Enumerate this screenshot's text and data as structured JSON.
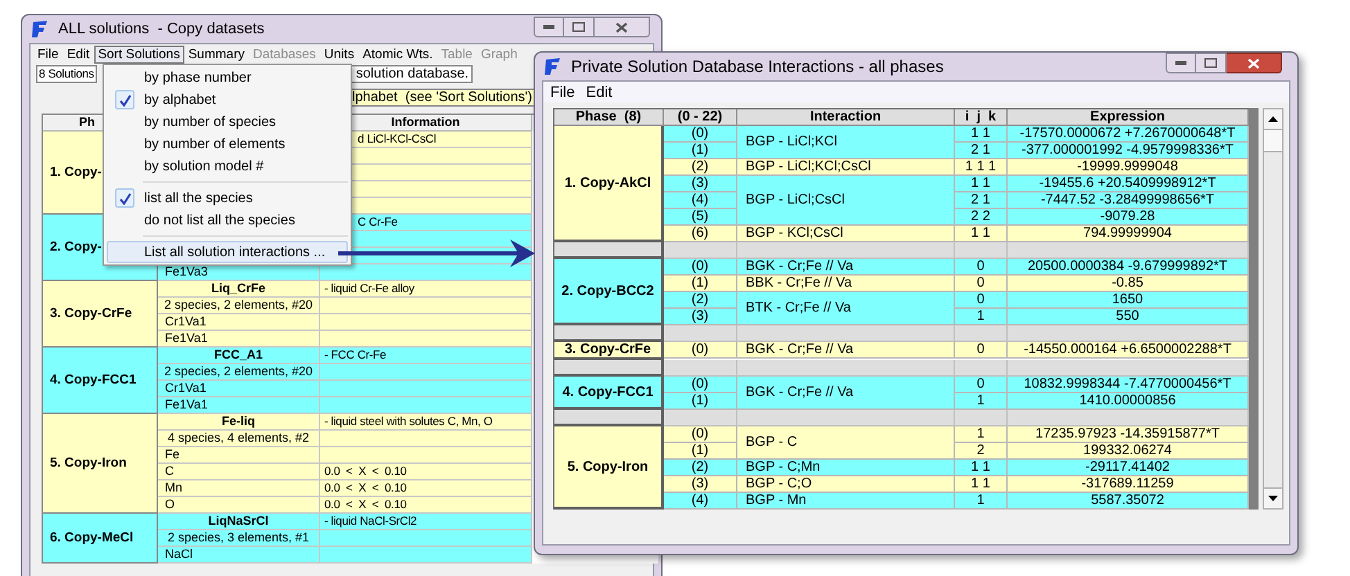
{
  "left_window": {
    "title": "ALL solutions  - Copy datasets",
    "active": false,
    "menu": [
      {
        "label": "File",
        "disabled": false,
        "selected": false
      },
      {
        "label": "Edit",
        "disabled": false,
        "selected": false
      },
      {
        "label": "Sort Solutions",
        "disabled": false,
        "selected": true
      },
      {
        "label": "Summary",
        "disabled": false,
        "selected": false
      },
      {
        "label": "Databases",
        "disabled": true,
        "selected": false
      },
      {
        "label": "Units",
        "disabled": false,
        "selected": false
      },
      {
        "label": "Atomic Wts.",
        "disabled": false,
        "selected": false
      },
      {
        "label": "Table",
        "disabled": true,
        "selected": false
      },
      {
        "label": "Graph",
        "disabled": true,
        "selected": false
      }
    ],
    "count_box": "8 Solutions",
    "source_box": "solution database.",
    "sort_note": "lphabet  (see 'Sort Solutions')",
    "table": {
      "columns": [
        "Ph",
        "Information"
      ],
      "groups": [
        {
          "phase": "1. Copy-",
          "rows": [
            {
              "kind": "name",
              "info": "d LiCl-KCl-CsCl"
            },
            {
              "kind": "count"
            },
            {
              "kind": "species"
            },
            {
              "kind": "species"
            },
            {
              "kind": "species"
            }
          ]
        },
        {
          "phase": "2. Copy-",
          "rows": [
            {
              "kind": "name",
              "info": "C Cr-Fe"
            },
            {
              "kind": "count"
            },
            {
              "kind": "species"
            },
            {
              "kind": "species",
              "name": "Fe1Va3"
            }
          ]
        },
        {
          "phase": "3. Copy-CrFe",
          "rows": [
            {
              "kind": "name",
              "name": "Liq_CrFe",
              "info": "- liquid Cr-Fe alloy"
            },
            {
              "kind": "count",
              "name": "2 species, 2 elements, #20"
            },
            {
              "kind": "species",
              "name": "Cr1Va1"
            },
            {
              "kind": "species",
              "name": "Fe1Va1"
            }
          ]
        },
        {
          "phase": "4. Copy-FCC1",
          "rows": [
            {
              "kind": "name",
              "name": "FCC_A1",
              "info": "- FCC Cr-Fe"
            },
            {
              "kind": "count",
              "name": "2 species, 2 elements, #20"
            },
            {
              "kind": "species",
              "name": "Cr1Va1"
            },
            {
              "kind": "species",
              "name": "Fe1Va1"
            }
          ]
        },
        {
          "phase": "5. Copy-Iron",
          "rows": [
            {
              "kind": "name",
              "name": "Fe-liq",
              "info": "- liquid steel with solutes C, Mn, O"
            },
            {
              "kind": "count",
              "name": "4 species, 4 elements, #2"
            },
            {
              "kind": "species",
              "name": "Fe"
            },
            {
              "kind": "species",
              "name": "C",
              "info": "0.0  <  X  <  0.10"
            },
            {
              "kind": "species",
              "name": "Mn",
              "info": "0.0  <  X  <  0.10"
            },
            {
              "kind": "species",
              "name": "O",
              "info": "0.0  <  X  <  0.10"
            }
          ]
        },
        {
          "phase": "6. Copy-MeCl",
          "rows": [
            {
              "kind": "name",
              "name": "LiqNaSrCl",
              "info": "- liquid NaCl-SrCl2"
            },
            {
              "kind": "count",
              "name": "2 species, 3 elements, #1"
            },
            {
              "kind": "species",
              "name": "NaCl"
            }
          ]
        }
      ]
    }
  },
  "sort_menu": {
    "items": [
      {
        "kind": "option",
        "label": "by phase number",
        "checked": false,
        "highlighted": false
      },
      {
        "kind": "option",
        "label": "by alphabet",
        "checked": true,
        "highlighted": false
      },
      {
        "kind": "option",
        "label": "by number of species",
        "checked": false,
        "highlighted": false
      },
      {
        "kind": "option",
        "label": "by number of elements",
        "checked": false,
        "highlighted": false
      },
      {
        "kind": "option",
        "label": "by solution model #",
        "checked": false,
        "highlighted": false
      },
      {
        "kind": "separator"
      },
      {
        "kind": "option",
        "label": "list all the species",
        "checked": true,
        "highlighted": false
      },
      {
        "kind": "option",
        "label": "do not list all the species",
        "checked": false,
        "highlighted": false
      },
      {
        "kind": "separator"
      },
      {
        "kind": "option",
        "label": "List all solution interactions ...",
        "checked": false,
        "highlighted": true
      }
    ]
  },
  "right_window": {
    "title": "Private Solution Database Interactions - all phases",
    "active": true,
    "menu": [
      "File",
      "Edit"
    ],
    "table": {
      "columns": [
        "Phase  (8)",
        "(0 - 22)",
        "Interaction",
        "i  j  k",
        "Expression"
      ],
      "phases": [
        {
          "phase": "1. Copy-AkCl",
          "interactions": [
            {
              "name": "BGP - LiCl;KCl",
              "terms": [
                {
                  "index": "(0)",
                  "ijk": "1 1",
                  "expression": "-17570.0000672 +7.2670000648*T"
                },
                {
                  "index": "(1)",
                  "ijk": "2 1",
                  "expression": "-377.000001992 -4.9579998336*T"
                }
              ]
            },
            {
              "name": "BGP - LiCl;KCl;CsCl",
              "terms": [
                {
                  "index": "(2)",
                  "ijk": "1 1 1",
                  "expression": "-19999.9999048"
                }
              ]
            },
            {
              "name": "BGP - LiCl;CsCl",
              "terms": [
                {
                  "index": "(3)",
                  "ijk": "1 1",
                  "expression": "-19455.6 +20.5409998912*T"
                },
                {
                  "index": "(4)",
                  "ijk": "2 1",
                  "expression": "-7447.52 -3.28499998656*T"
                },
                {
                  "index": "(5)",
                  "ijk": "2 2",
                  "expression": "-9079.28"
                }
              ]
            },
            {
              "name": "BGP - KCl;CsCl",
              "terms": [
                {
                  "index": "(6)",
                  "ijk": "1 1",
                  "expression": "794.99999904"
                }
              ]
            }
          ]
        },
        {
          "phase": "2. Copy-BCC2",
          "interactions": [
            {
              "name": "BGK - Cr;Fe // Va",
              "terms": [
                {
                  "index": "(0)",
                  "ijk": "0",
                  "expression": "20500.0000384 -9.679999892*T"
                }
              ]
            },
            {
              "name": "BBK - Cr;Fe // Va",
              "terms": [
                {
                  "index": "(1)",
                  "ijk": "0",
                  "expression": "-0.85"
                }
              ]
            },
            {
              "name": "BTK - Cr;Fe // Va",
              "terms": [
                {
                  "index": "(2)",
                  "ijk": "0",
                  "expression": "1650"
                },
                {
                  "index": "(3)",
                  "ijk": "1",
                  "expression": "550"
                }
              ]
            }
          ]
        },
        {
          "phase": "3. Copy-CrFe",
          "interactions": [
            {
              "name": "BGK - Cr;Fe // Va",
              "terms": [
                {
                  "index": "(0)",
                  "ijk": "0",
                  "expression": "-14550.000164 +6.6500002288*T"
                }
              ]
            }
          ]
        },
        {
          "phase": "4. Copy-FCC1",
          "interactions": [
            {
              "name": "BGK - Cr;Fe // Va",
              "terms": [
                {
                  "index": "(0)",
                  "ijk": "0",
                  "expression": "10832.9998344 -7.4770000456*T"
                },
                {
                  "index": "(1)",
                  "ijk": "1",
                  "expression": "1410.00000856"
                }
              ]
            }
          ]
        },
        {
          "phase": "5. Copy-Iron",
          "interactions": [
            {
              "name": "BGP - C",
              "terms": [
                {
                  "index": "(0)",
                  "ijk": "1",
                  "expression": "17235.97923 -14.35915877*T"
                },
                {
                  "index": "(1)",
                  "ijk": "2",
                  "expression": "199332.06274"
                }
              ]
            },
            {
              "name": "BGP - C;Mn",
              "terms": [
                {
                  "index": "(2)",
                  "ijk": "1 1",
                  "expression": "-29117.41402"
                }
              ]
            },
            {
              "name": "BGP - C;O",
              "terms": [
                {
                  "index": "(3)",
                  "ijk": "1 1",
                  "expression": "-317689.11259"
                }
              ]
            },
            {
              "name": "BGP - Mn",
              "terms": [
                {
                  "index": "(4)",
                  "ijk": "1",
                  "expression": "5587.35072"
                }
              ]
            }
          ]
        }
      ]
    }
  }
}
